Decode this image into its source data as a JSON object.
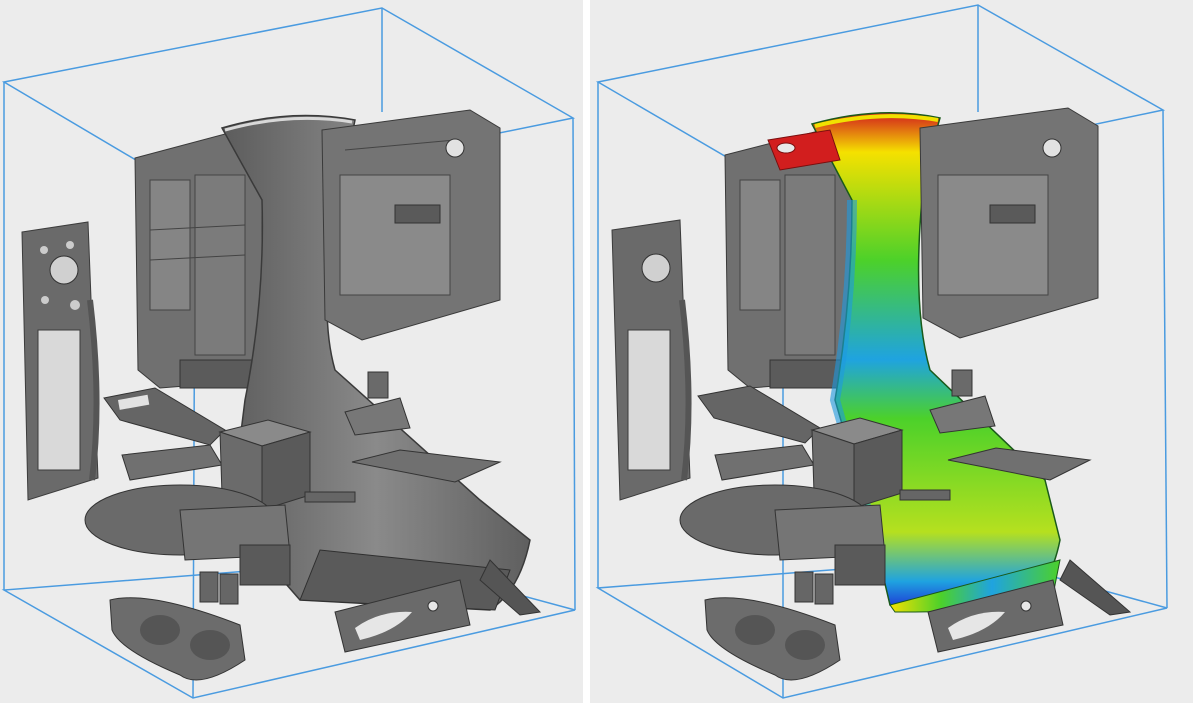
{
  "views": [
    {
      "id": "left",
      "mode": "geometry",
      "highlighted_part": ""
    },
    {
      "id": "right",
      "mode": "analysis-overlay",
      "highlighted_part": "large-duct-part"
    }
  ],
  "colors": {
    "background": "#ececec",
    "build_volume_edges": "#4a9be0",
    "part_gray": "#6f6f6f",
    "part_gray_dark": "#4a4a4a",
    "part_gray_light": "#9a9a9a",
    "heatmap": [
      "#d21e1e",
      "#f5e100",
      "#4cd12a",
      "#1fa3e0",
      "#1e3fd6"
    ]
  }
}
